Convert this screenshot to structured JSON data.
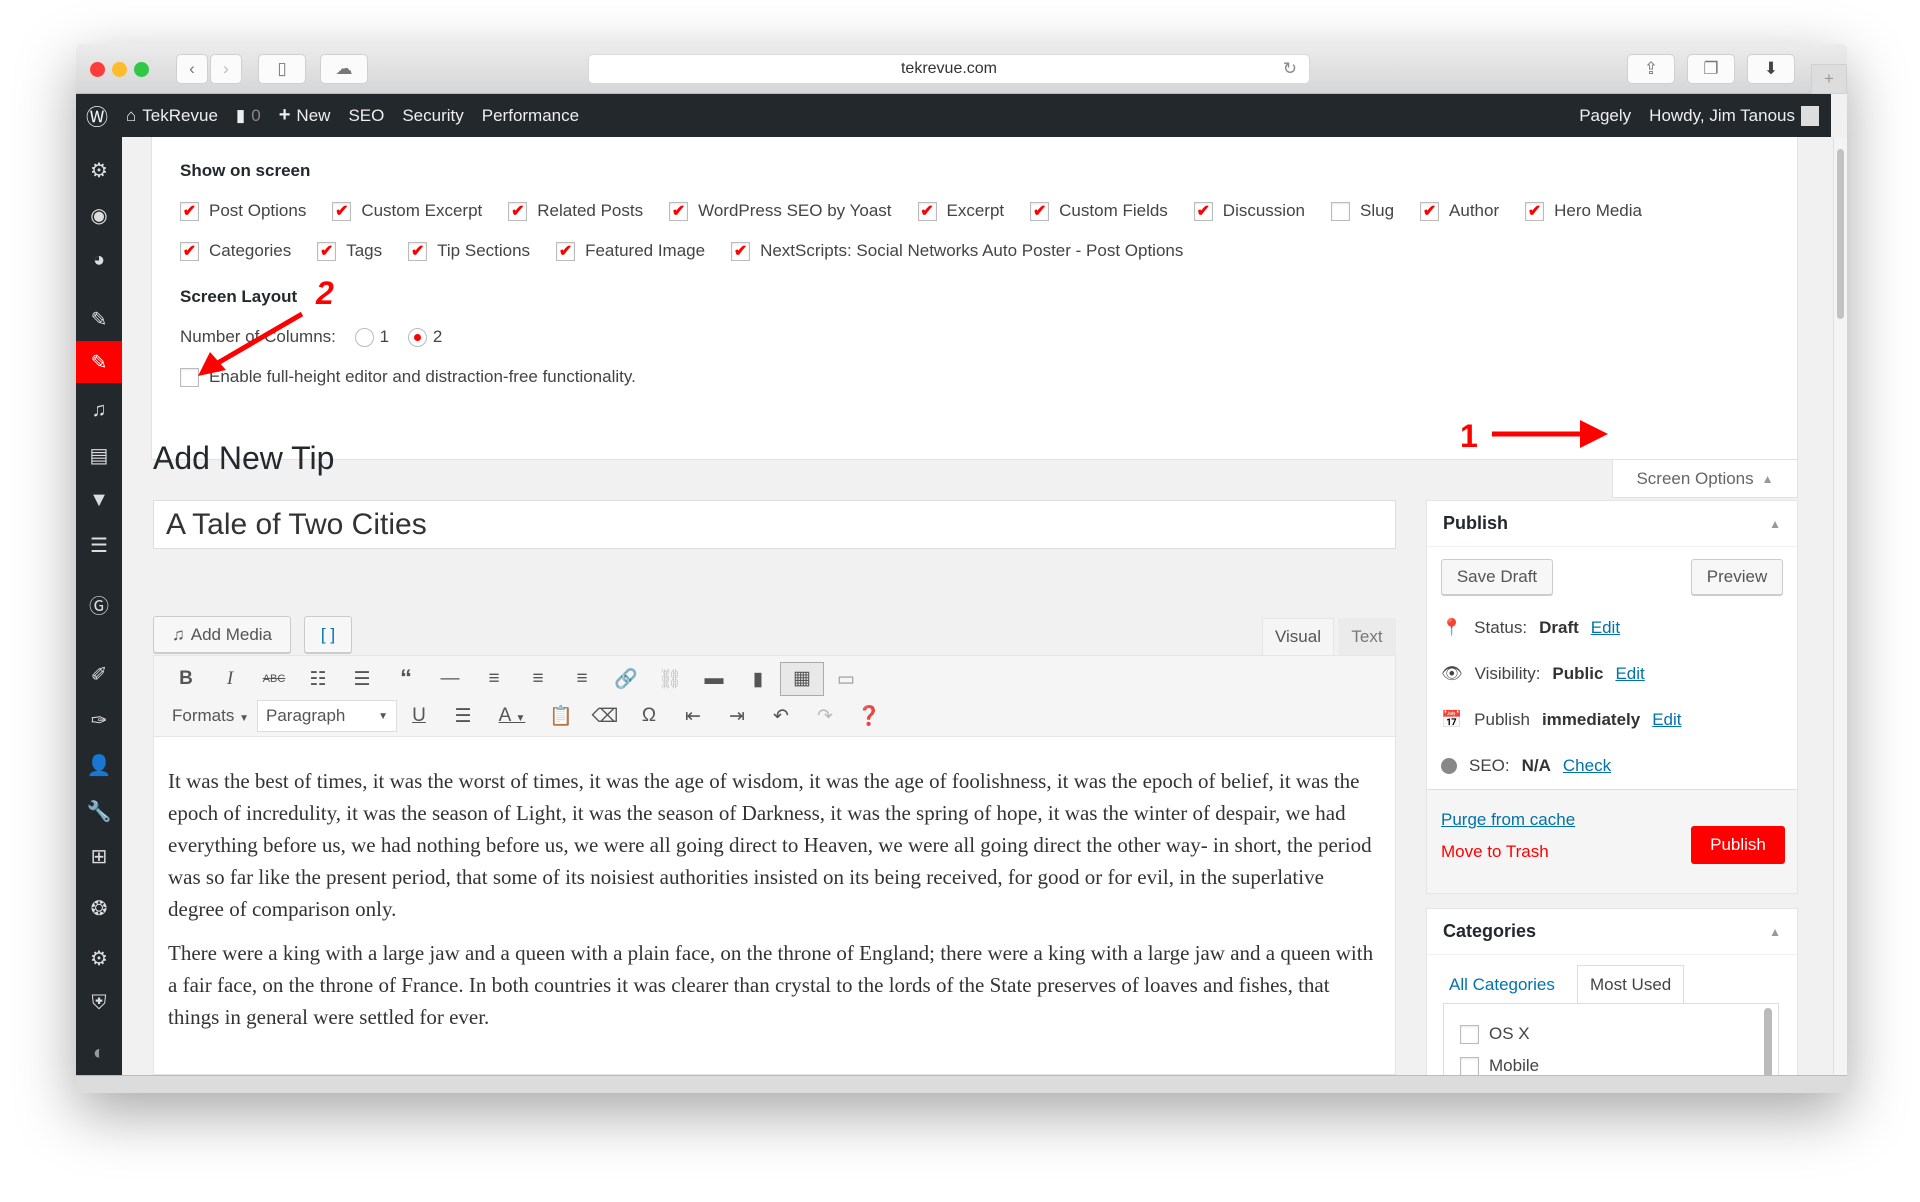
{
  "browser": {
    "url": "tekrevue.com"
  },
  "adminbar": {
    "site": "TekRevue",
    "comments": "0",
    "new": "New",
    "seo": "SEO",
    "security": "Security",
    "performance": "Performance",
    "pagely": "Pagely",
    "howdy": "Howdy, Jim Tanous"
  },
  "screen_options": {
    "show_heading": "Show on screen",
    "row1": [
      {
        "label": "Post Options",
        "checked": true
      },
      {
        "label": "Custom Excerpt",
        "checked": true
      },
      {
        "label": "Related Posts",
        "checked": true
      },
      {
        "label": "WordPress SEO by Yoast",
        "checked": true
      },
      {
        "label": "Excerpt",
        "checked": true
      },
      {
        "label": "Custom Fields",
        "checked": true
      },
      {
        "label": "Discussion",
        "checked": true
      },
      {
        "label": "Slug",
        "checked": false
      },
      {
        "label": "Author",
        "checked": true
      },
      {
        "label": "Hero Media",
        "checked": true
      }
    ],
    "row2": [
      {
        "label": "Categories",
        "checked": true
      },
      {
        "label": "Tags",
        "checked": true
      },
      {
        "label": "Tip Sections",
        "checked": true
      },
      {
        "label": "Featured Image",
        "checked": true
      },
      {
        "label": "NextScripts: Social Networks Auto Poster - Post Options",
        "checked": true
      }
    ],
    "layout_heading": "Screen Layout",
    "columns_label": "Number of Columns:",
    "col1": "1",
    "col2": "2",
    "selected_columns": "2",
    "fullheight_label": "Enable full-height editor and distraction-free functionality.",
    "fullheight_checked": false,
    "tab_label": "Screen Options"
  },
  "annotations": {
    "one": "1",
    "two": "2",
    "color": "#ff0000"
  },
  "page": {
    "title": "Add New Tip",
    "post_title": "A Tale of Two Cities"
  },
  "editor": {
    "add_media": "Add Media",
    "visual_tab": "Visual",
    "text_tab": "Text",
    "formats": "Formats",
    "paragraph": "Paragraph",
    "paragraphs": [
      "It was the best of times, it was the worst of times, it was the age of wisdom, it was the age of foolishness, it was the epoch of belief, it was the epoch of incredulity, it was the season of Light, it was the season of Darkness, it was the spring of hope, it was the winter of despair, we had everything before us, we had nothing before us, we were all going direct to Heaven, we were all going direct the other way- in short, the period was so far like the present period, that some of its noisiest authorities insisted on its being received, for good or for evil, in the superlative degree of comparison only.",
      "There were a king with a large jaw and a queen with a plain face, on the throne of England; there were a king with a large jaw and a queen with a fair face, on the throne of France. In both countries it was clearer than crystal to the lords of the State preserves of loaves and fishes, that things in general were settled for ever."
    ]
  },
  "publish": {
    "title": "Publish",
    "save_draft": "Save Draft",
    "preview": "Preview",
    "status_label": "Status:",
    "status_value": "Draft",
    "visibility_label": "Visibility:",
    "visibility_value": "Public",
    "publish_label": "Publish",
    "publish_value": "immediately",
    "seo_label": "SEO:",
    "seo_value": "N/A",
    "check": "Check",
    "edit": "Edit",
    "purge": "Purge from cache",
    "trash": "Move to Trash",
    "publish_button": "Publish",
    "accent": "#ff0000"
  },
  "categories": {
    "title": "Categories",
    "tab_all": "All Categories",
    "tab_most": "Most Used",
    "items": [
      "OS X",
      "Mobile"
    ]
  }
}
